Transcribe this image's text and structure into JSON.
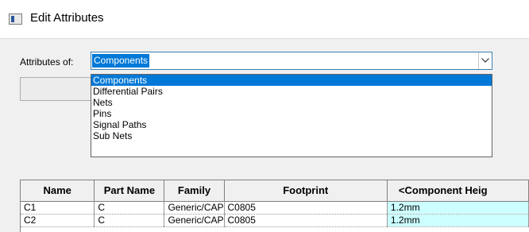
{
  "window": {
    "title": "Edit Attributes",
    "icon": "window-icon"
  },
  "attributes": {
    "label": "Attributes of:",
    "selected": "Components",
    "options": [
      "Components",
      "Differential Pairs",
      "Nets",
      "Pins",
      "Signal Paths",
      "Sub Nets"
    ]
  },
  "table": {
    "headers": [
      "Name",
      "Part Name",
      "Family",
      "Footprint",
      "<Component Heig"
    ],
    "rows": [
      [
        "C1",
        "C",
        "Generic/CAP",
        "C0805",
        "1.2mm"
      ],
      [
        "C2",
        "C",
        "Generic/CAP",
        "C0805",
        "1.2mm"
      ]
    ]
  },
  "colors": {
    "selection": "#0078d7",
    "highlight_cell": "#ccffff"
  }
}
